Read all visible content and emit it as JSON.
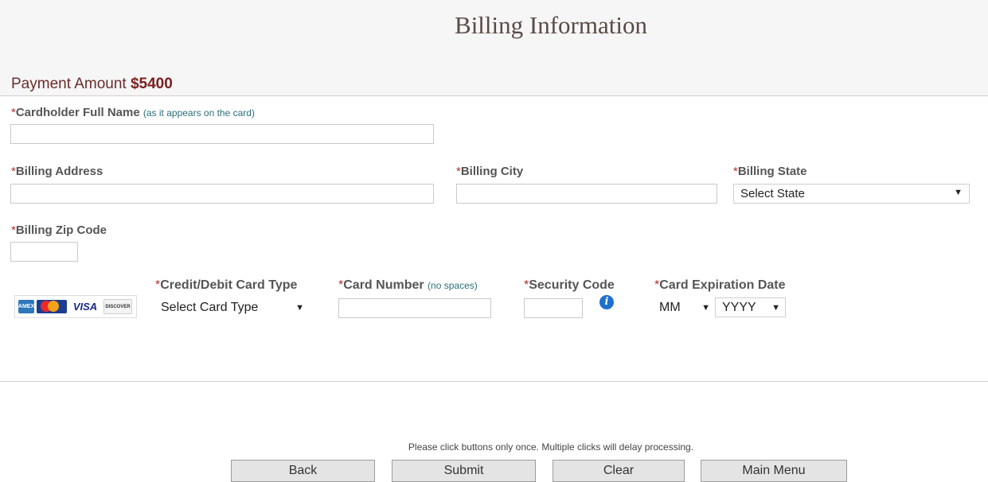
{
  "page": {
    "title": "Billing Information",
    "payment_label": "Payment Amount",
    "payment_amount": "$5400"
  },
  "form": {
    "cardholder": {
      "required_mark": "*",
      "label": "Cardholder Full Name",
      "hint": "(as it appears on the card)",
      "value": ""
    },
    "address": {
      "required_mark": "*",
      "label": "Billing Address",
      "value": ""
    },
    "city": {
      "required_mark": "*",
      "label": "Billing City",
      "value": ""
    },
    "state": {
      "required_mark": "*",
      "label": "Billing State",
      "selected": "Select State"
    },
    "zip": {
      "required_mark": "*",
      "label": "Billing Zip Code",
      "value": ""
    },
    "card_type": {
      "required_mark": "*",
      "label": "Credit/Debit Card Type",
      "selected": "Select Card Type"
    },
    "card_number": {
      "required_mark": "*",
      "label": "Card Number",
      "hint": "(no spaces)",
      "value": ""
    },
    "security_code": {
      "required_mark": "*",
      "label": "Security Code",
      "value": "",
      "info_icon": "info-icon"
    },
    "expiration": {
      "required_mark": "*",
      "label": "Card Expiration Date",
      "month": "MM",
      "year": "YYYY"
    }
  },
  "card_logos": [
    "amex",
    "mastercard",
    "visa",
    "discover"
  ],
  "card_logo_text": {
    "amex": "AMEX",
    "visa": "VISA",
    "discover": "DISCOVER"
  },
  "notice": "Please click buttons only once. Multiple clicks will delay processing.",
  "buttons": {
    "back": "Back",
    "submit": "Submit",
    "clear": "Clear",
    "main_menu": "Main Menu"
  },
  "colors": {
    "title": "#5a4a45",
    "amount": "#7a2020",
    "required": "#b03030",
    "hint": "#2a6f7a",
    "info": "#1e6fd0"
  }
}
